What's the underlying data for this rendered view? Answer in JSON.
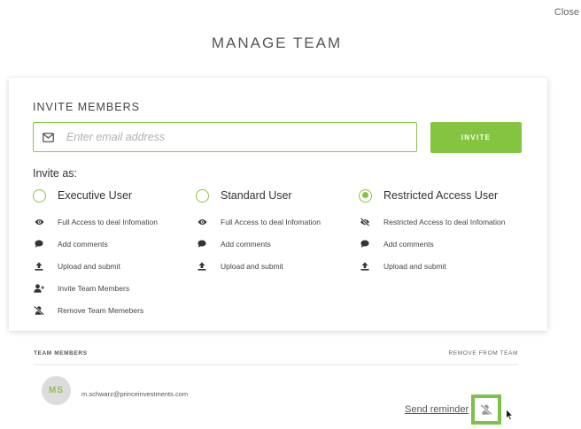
{
  "header": {
    "close_label": "Close",
    "title": "MANAGE TEAM"
  },
  "invite": {
    "heading": "INVITE MEMBERS",
    "email_placeholder": "Enter email address",
    "email_value": "",
    "button_label": "INVITE",
    "invite_as_label": "Invite as:",
    "selected_role": "Restricted Access User",
    "roles": [
      {
        "label": "Executive User",
        "selected": false,
        "permissions": [
          {
            "icon": "eye-icon",
            "text": "Full Access to deal Infomation"
          },
          {
            "icon": "comment-icon",
            "text": "Add comments"
          },
          {
            "icon": "upload-icon",
            "text": "Upload and submit"
          },
          {
            "icon": "add-user-icon",
            "text": "Invite Team Members"
          },
          {
            "icon": "remove-user-icon",
            "text": "Remove Team Memebers"
          }
        ]
      },
      {
        "label": "Standard User",
        "selected": false,
        "permissions": [
          {
            "icon": "eye-icon",
            "text": "Full Access to deal Infomation"
          },
          {
            "icon": "comment-icon",
            "text": "Add comments"
          },
          {
            "icon": "upload-icon",
            "text": "Upload and submit"
          }
        ]
      },
      {
        "label": "Restricted Access User",
        "selected": true,
        "permissions": [
          {
            "icon": "eye-slash-icon",
            "text": "Restricted Access to deal Infomation"
          },
          {
            "icon": "comment-icon",
            "text": "Add comments"
          },
          {
            "icon": "upload-icon",
            "text": "Upload and submit"
          }
        ]
      }
    ]
  },
  "team": {
    "members_heading": "TEAM MEMBERS",
    "remove_heading": "REMOVE FROM TEAM",
    "members": [
      {
        "initials": "MS",
        "email": "m.schwarz@princeinvestments.com",
        "reminder_label": "Send reminder"
      }
    ]
  },
  "colors": {
    "accent": "#84c440",
    "accent_border": "#8bc34a",
    "text": "#333333",
    "avatar_bg": "#dcdcdc"
  }
}
